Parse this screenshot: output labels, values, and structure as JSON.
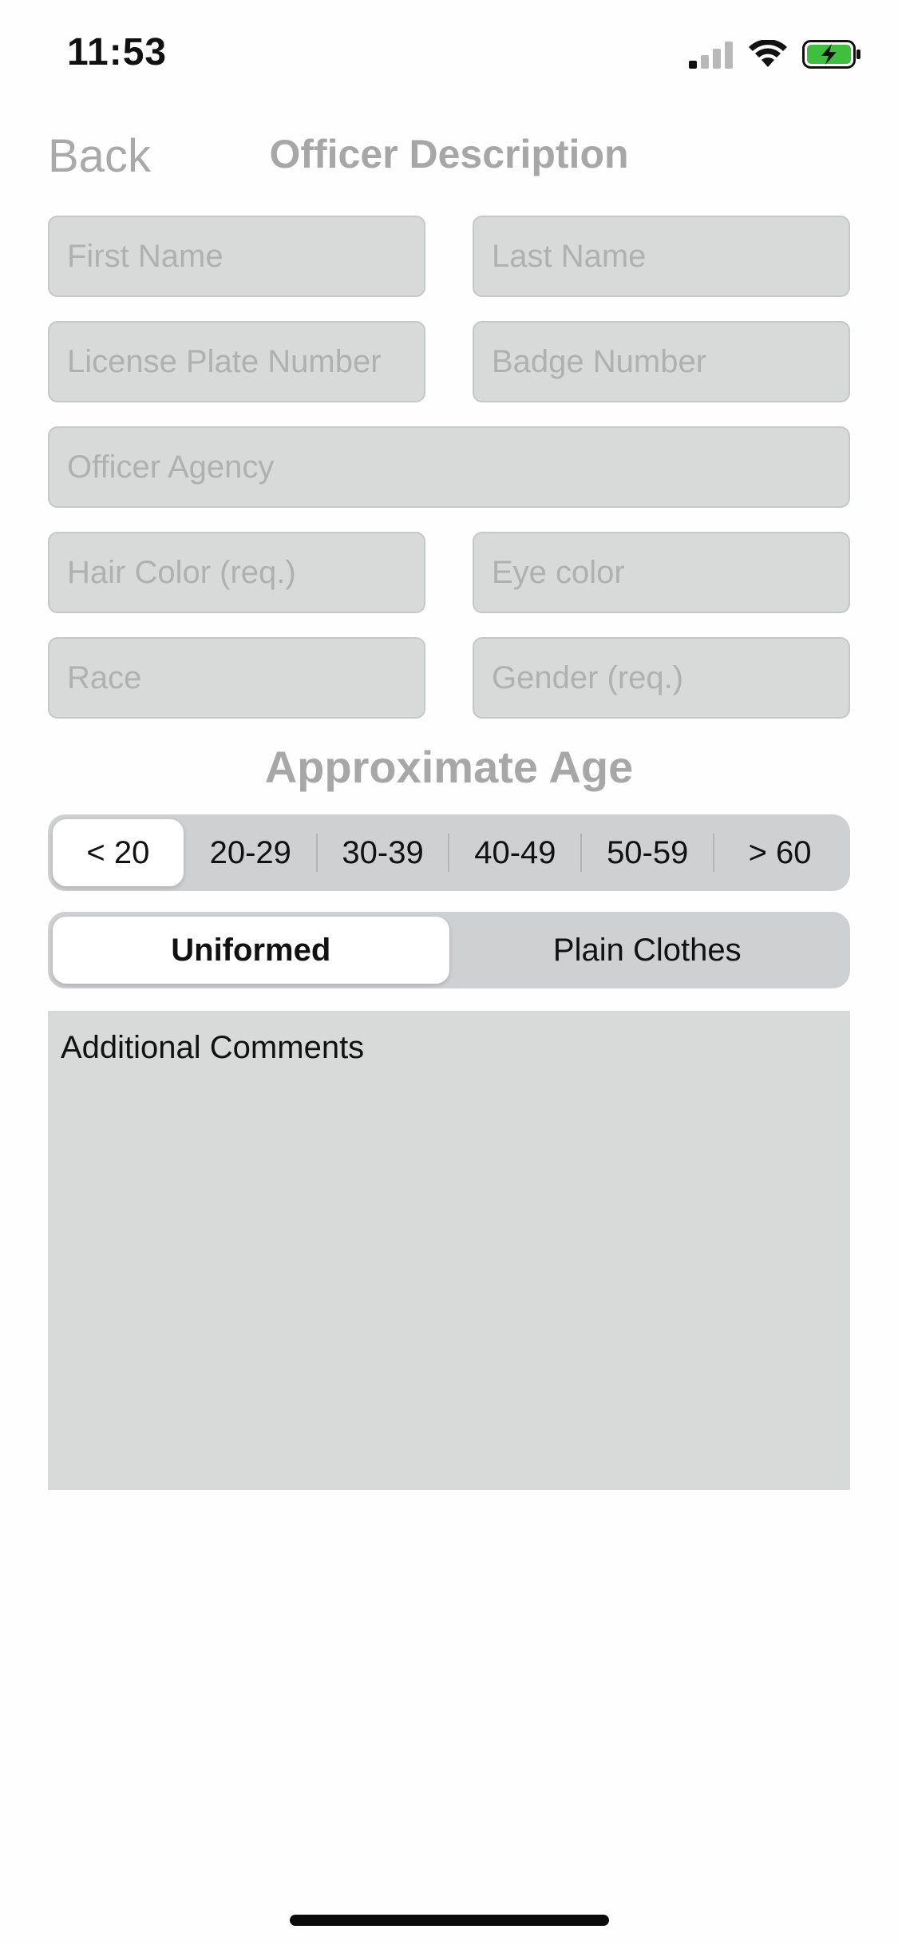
{
  "status_bar": {
    "time": "11:53",
    "icons": [
      "cellular-signal-icon",
      "wifi-icon",
      "battery-charging-icon"
    ],
    "battery_color": "#3fbf3f"
  },
  "nav": {
    "back_label": "Back",
    "title": "Officer Description"
  },
  "fields": {
    "first_name": {
      "placeholder": "First Name",
      "value": ""
    },
    "last_name": {
      "placeholder": "Last Name",
      "value": ""
    },
    "license_plate": {
      "placeholder": "License Plate Number",
      "value": ""
    },
    "badge_number": {
      "placeholder": "Badge Number",
      "value": ""
    },
    "officer_agency": {
      "placeholder": "Officer Agency",
      "value": ""
    },
    "hair_color": {
      "placeholder": "Hair Color (req.)",
      "value": ""
    },
    "eye_color": {
      "placeholder": "Eye color",
      "value": ""
    },
    "race": {
      "placeholder": "Race",
      "value": ""
    },
    "gender": {
      "placeholder": "Gender (req.)",
      "value": ""
    }
  },
  "age": {
    "heading": "Approximate Age",
    "options": [
      "< 20",
      "20-29",
      "30-39",
      "40-49",
      "50-59",
      "> 60"
    ],
    "selected": "< 20"
  },
  "attire": {
    "options": [
      "Uniformed",
      "Plain Clothes"
    ],
    "selected": "Uniformed"
  },
  "comments": {
    "text": "Additional Comments"
  }
}
